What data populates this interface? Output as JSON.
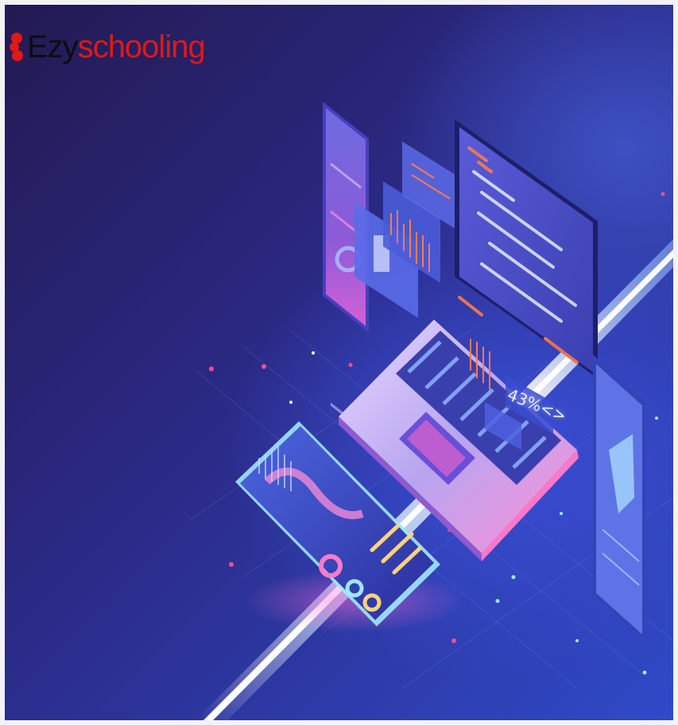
{
  "logo": {
    "part1": "Ezy",
    "part2": "schooling",
    "mark_icon": "logo-mark-icon"
  },
  "laptop_screen": {
    "percentage_label": "43%",
    "chevron": "<>"
  },
  "colors": {
    "background_dark": "#231a52",
    "background_blue": "#2f4ac8",
    "logo_red": "#e01818",
    "logo_black": "#0d0d0d",
    "neon_cyan": "#9ee7ff",
    "neon_pink": "#ff5fd0",
    "accent_orange": "#ff7a4a"
  }
}
